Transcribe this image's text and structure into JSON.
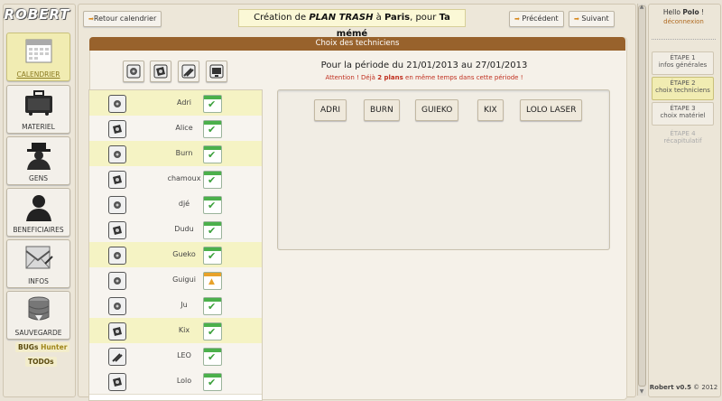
{
  "app": {
    "logo": "ROBERT"
  },
  "sidebar": {
    "items": [
      {
        "label": "CALENDRIER",
        "icon": "calendar-icon"
      },
      {
        "label": "MATERIEL",
        "icon": "equipment-case-icon"
      },
      {
        "label": "GENS",
        "icon": "person-hat-icon"
      },
      {
        "label": "BENEFICIAIRES",
        "icon": "person-silhouette-icon"
      },
      {
        "label": "INFOS",
        "icon": "envelope-icon"
      },
      {
        "label": "SAUVEGARDE",
        "icon": "database-save-icon"
      }
    ],
    "bugs_label_a": "BUGs",
    "bugs_label_b": "Hunter",
    "todos_label": "TODOs"
  },
  "header": {
    "back_label": "Retour calendrier",
    "title_prefix": "Création de",
    "plan_name": "PLAN TRASH",
    "title_mid": "à",
    "city": "Paris",
    "title_for": ", pour",
    "client": "Ta mémé",
    "prev_label": "Précédent",
    "next_label": "Suivant"
  },
  "panel": {
    "heading": "Choix des techniciens",
    "filters": [
      "sound-icon",
      "light-icon",
      "tools-icon",
      "video-icon"
    ],
    "period_text": "Pour la période du 21/01/2013 au 27/01/2013",
    "warning_a": "Attention ! Déjà",
    "warning_count": "2 plans",
    "warning_b": "en même temps dans cette période !"
  },
  "technicians": [
    {
      "name": "Adri",
      "type": "sound-icon",
      "available": true
    },
    {
      "name": "Alice",
      "type": "light-icon",
      "available": true
    },
    {
      "name": "Burn",
      "type": "sound-icon",
      "available": true
    },
    {
      "name": "chamoux",
      "type": "light-icon",
      "available": true
    },
    {
      "name": "djé",
      "type": "sound-icon",
      "available": true
    },
    {
      "name": "Dudu",
      "type": "light-icon",
      "available": true
    },
    {
      "name": "Gueko",
      "type": "sound-icon",
      "available": true
    },
    {
      "name": "Guigui",
      "type": "sound-icon",
      "available": false
    },
    {
      "name": "Ju",
      "type": "sound-icon",
      "available": true
    },
    {
      "name": "Kix",
      "type": "light-icon",
      "available": true
    },
    {
      "name": "LEO",
      "type": "tools-icon",
      "available": true
    },
    {
      "name": "Lolo",
      "type": "light-icon",
      "available": true
    }
  ],
  "selected": [
    "ADRI",
    "BURN",
    "GUIEKO",
    "KIX",
    "LOLO LASER"
  ],
  "right": {
    "hello": "Hello",
    "user": "Polo",
    "hello_end": "!",
    "logout": "déconnexion",
    "steps": [
      {
        "title": "ÉTAPE 1",
        "sub": "infos générales",
        "state": "done"
      },
      {
        "title": "ÉTAPE 2",
        "sub": "choix techniciens",
        "state": "active"
      },
      {
        "title": "ÉTAPE 3",
        "sub": "choix matériel",
        "state": "done"
      },
      {
        "title": "ÉTAPE 4",
        "sub": "récapitulatif",
        "state": "disabled"
      }
    ],
    "version_name": "Robert v0.5",
    "version_rest": "© 2012"
  },
  "colors": {
    "accent": "#98622c",
    "active": "#f1ecb2",
    "warning": "#c03020",
    "ok": "#4bb04b"
  }
}
